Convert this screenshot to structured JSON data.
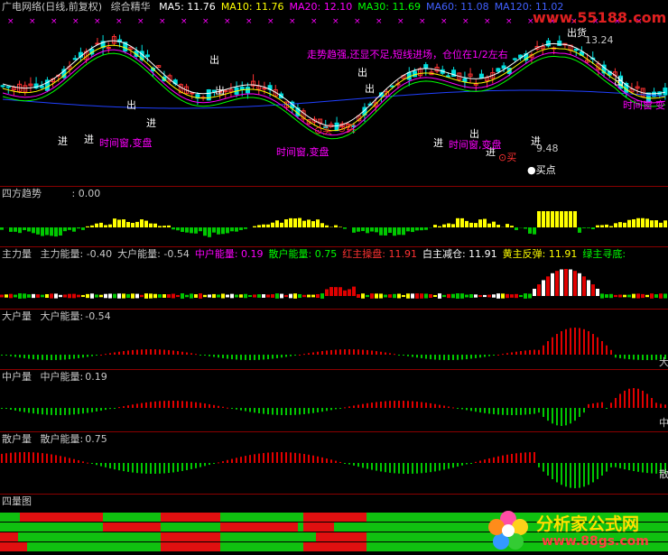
{
  "colors": {
    "bg": "#000000",
    "up": "#ff3232",
    "down": "#00e0e0",
    "ma5": "#ffffff",
    "ma10": "#ffff00",
    "ma20": "#ff00ff",
    "ma30": "#00ff00",
    "ma60": "#0000ff",
    "yellow": "#ffff00",
    "green": "#00c800",
    "red": "#e00000",
    "magenta": "#ff00ff",
    "grid_red": "#8a0000"
  },
  "main": {
    "title": "广电网络(日线,前复权)",
    "indicator": "综合精华",
    "ma": [
      {
        "label": "MA5:",
        "value": "11.76",
        "color": "#ffffff"
      },
      {
        "label": "MA10:",
        "value": "11.76",
        "color": "#ffff00"
      },
      {
        "label": "MA20:",
        "value": "12.10",
        "color": "#ff00ff"
      },
      {
        "label": "MA30:",
        "value": "11.69",
        "color": "#00ff00"
      },
      {
        "label": "MA60:",
        "value": "11.08",
        "color": "#4060ff"
      },
      {
        "label": "MA120:",
        "value": "11.02",
        "color": "#4060ff"
      }
    ],
    "note": "走势趋强,还显不足,短线进场，仓位在1/2左右",
    "high_label": "13.24",
    "low_label": "9.48",
    "buy_point_label": "●买点",
    "signals": [
      "进",
      "进",
      "出",
      "进",
      "出",
      "出",
      "进",
      "出",
      "进",
      "进",
      "出",
      "出",
      "出"
    ],
    "pink_signals": [
      "时间窗,变盘",
      "时间窗,变盘",
      "时间窗,变盘",
      "时间窗"
    ],
    "buy_marks": [
      "⊙买",
      "⊙买",
      "⊙买"
    ],
    "sell_label": "出货",
    "right_marks": [
      "变"
    ]
  },
  "panel_sifang": {
    "title": "四方趋势",
    "value_label": ": 0.00"
  },
  "panel_zhuli": {
    "title": "主力量",
    "items": [
      {
        "label": "主力能量:",
        "value": "-0.40",
        "color": "#c8c8c8"
      },
      {
        "label": "大户能量:",
        "value": "-0.54",
        "color": "#c8c8c8"
      },
      {
        "label": "中户能量:",
        "value": "0.19",
        "color": "#ff00ff"
      },
      {
        "label": "散户能量:",
        "value": "0.75",
        "color": "#00ff00"
      },
      {
        "label": "红主操盘:",
        "value": "11.91",
        "color": "#ff3232"
      },
      {
        "label": "白主减仓:",
        "value": "11.91",
        "color": "#ffffff"
      },
      {
        "label": "黄主反弹:",
        "value": "11.91",
        "color": "#ffff00"
      },
      {
        "label": "绿主寻底:",
        "value": "",
        "color": "#00ff00"
      }
    ]
  },
  "panel_dahu": {
    "title": "大户量",
    "label": "大户能量:",
    "value": "-0.54",
    "right_tag": "大"
  },
  "panel_zhonghu": {
    "title": "中户量",
    "label": "中户能量:",
    "value": "0.19",
    "right_tag": "中"
  },
  "panel_sanhu": {
    "title": "散户量",
    "label": "散户能量:",
    "value": "0.75",
    "right_tag": "散"
  },
  "panel_sixiang": {
    "title": "四量图"
  },
  "watermark": {
    "top": "www.55188.com",
    "bottom_main": "分析家公式网",
    "bottom_url": "www.88gs.com"
  }
}
